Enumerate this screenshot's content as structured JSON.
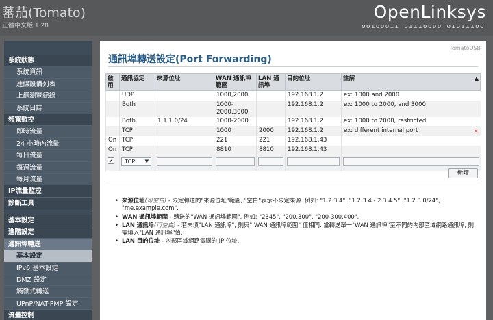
{
  "header": {
    "brand": "蕃茄(Tomato)",
    "brand_sub": "正體中文版 1.28",
    "logo": "OpenLinksys",
    "logo_bits": "ooıoooıı oıııoooo oıoıııoo"
  },
  "sidebar": {
    "items": [
      {
        "label": "系統狀態",
        "level": 0
      },
      {
        "label": "系統資訊",
        "level": 1
      },
      {
        "label": "連線設備列表",
        "level": 1
      },
      {
        "label": "上網瀏覽紀錄",
        "level": 1
      },
      {
        "label": "系統日誌",
        "level": 1
      },
      {
        "label": "頻寬監控",
        "level": 0
      },
      {
        "label": "即時流量",
        "level": 1
      },
      {
        "label": "24 小時內流量",
        "level": 1
      },
      {
        "label": "每日流量",
        "level": 1
      },
      {
        "label": "每週流量",
        "level": 1
      },
      {
        "label": "每月流量",
        "level": 1
      },
      {
        "label": "IP流量監控",
        "level": 0
      },
      {
        "label": "診斷工具",
        "level": 0
      },
      {
        "label": "",
        "level": 9
      },
      {
        "label": "基本設定",
        "level": 0
      },
      {
        "label": "進階設定",
        "level": 0
      },
      {
        "label": "通訊埠轉送",
        "level": 0,
        "active": true
      },
      {
        "label": "基本設定",
        "level": 1,
        "current": true
      },
      {
        "label": "IPv6 基本設定",
        "level": 1
      },
      {
        "label": "DMZ 設定",
        "level": 1
      },
      {
        "label": "觸發式轉送",
        "level": 1
      },
      {
        "label": "UPnP/NAT-PMP 設定",
        "level": 1
      },
      {
        "label": "流量控制",
        "level": 0
      }
    ]
  },
  "main": {
    "tomato_usb": "TomatoUSB",
    "title": "通訊埠轉送設定(Port Forwarding)",
    "table": {
      "headers": [
        "啟\n用",
        "通訊協定",
        "來源位址",
        "WAN 通訊埠\n範圍",
        "LAN 通\n訊埠",
        "目的位址",
        "註解"
      ],
      "sort_arrow": "▲",
      "rows": [
        {
          "on": "",
          "proto": "UDP",
          "src": "",
          "wan": "1000,2000",
          "lan": "",
          "dst": "192.168.1.2",
          "note": "ex: 1000 and 2000",
          "del": ""
        },
        {
          "on": "",
          "proto": "Both",
          "src": "",
          "wan": "1000-\n2000,3000",
          "lan": "",
          "dst": "192.168.1.2",
          "note": "ex: 1000 to 2000, and 3000",
          "del": ""
        },
        {
          "on": "",
          "proto": "Both",
          "src": "1.1.1.0/24",
          "wan": "1000-2000",
          "lan": "",
          "dst": "192.168.1.2",
          "note": "ex: 1000 to 2000, restricted",
          "del": ""
        },
        {
          "on": "",
          "proto": "TCP",
          "src": "",
          "wan": "1000",
          "lan": "2000",
          "dst": "192.168.1.2",
          "note": "ex: different internal port",
          "del": "×"
        },
        {
          "on": "On",
          "proto": "TCP",
          "src": "",
          "wan": "221",
          "lan": "221",
          "dst": "192.168.1.43",
          "note": "",
          "del": ""
        },
        {
          "on": "On",
          "proto": "TCP",
          "src": "",
          "wan": "8810",
          "lan": "8810",
          "dst": "192.168.1.43",
          "note": "",
          "del": ""
        }
      ],
      "edit_row": {
        "checkbox": "✔",
        "proto_selected": "TCP",
        "proto_arrow": "▼"
      }
    },
    "add_button": "新增",
    "notes": [
      {
        "term": "來源位址",
        "opt": "(可空白)",
        "text": " - 限定轉送的\"來源位址\"範圍, \"空白\"表示不限定來源. 例如: \"1.2.3.4\", \"1.2.3.4 - 2.3.4.5\", \"1.2.3.0/24\", \"me.example.com\"."
      },
      {
        "term": "WAN 通訊埠範圍",
        "opt": "",
        "text": " - 轉送的\"WAN 通訊埠範圍\". 例如: \"2345\", \"200,300\", \"200-300,400\"."
      },
      {
        "term": "LAN 通訊埠",
        "opt": "(可空白)",
        "text": " - 若未填\"LAN 通訊埠\", 則與\" WAN 通訊埠範圍\" 值相同. 當轉送單一\"WAN 通訊埠\"至不同的內部區域網路通訊埠, 則需填入\"LAN 通訊埠\"值."
      },
      {
        "term": "LAN 目的位址",
        "opt": "",
        "text": " - 內部區域網路電腦的 IP 位址."
      }
    ]
  }
}
